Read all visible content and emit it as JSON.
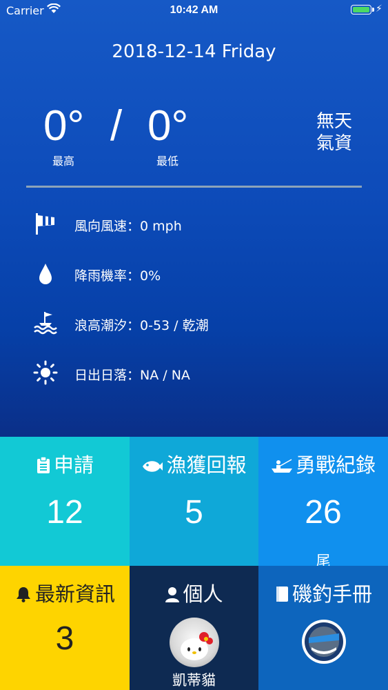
{
  "status_bar": {
    "carrier": "Carrier",
    "time": "10:42 AM"
  },
  "date": "2018-12-14 Friday",
  "weather": {
    "high": "0°",
    "separator": "/",
    "low": "0°",
    "high_label": "最高",
    "low_label": "最低",
    "condition": "無天氣資"
  },
  "details": [
    {
      "icon": "windsock-icon",
      "text": "風向風速：0 mph"
    },
    {
      "icon": "raindrop-icon",
      "text": "降雨機率：0%"
    },
    {
      "icon": "wave-tide-icon",
      "text": "浪高潮汐：0-53 / 乾潮"
    },
    {
      "icon": "sun-icon",
      "text": "日出日落：NA / NA"
    }
  ],
  "tiles": {
    "apply": {
      "label": "申請",
      "value": "12",
      "color": "#12c9d5"
    },
    "catch": {
      "label": "漁獲回報",
      "value": "5",
      "color": "#0fa8d8"
    },
    "record": {
      "label": "勇戰紀錄",
      "value": "26",
      "unit": "尾",
      "color": "#1090ee"
    },
    "news": {
      "label": "最新資訊",
      "value": "3",
      "color": "#fed400"
    },
    "personal": {
      "label": "個人",
      "name": "凱蒂貓",
      "color": "#0e2a52"
    },
    "manual": {
      "label": "磯釣手冊",
      "color": "#0d65bd"
    }
  }
}
